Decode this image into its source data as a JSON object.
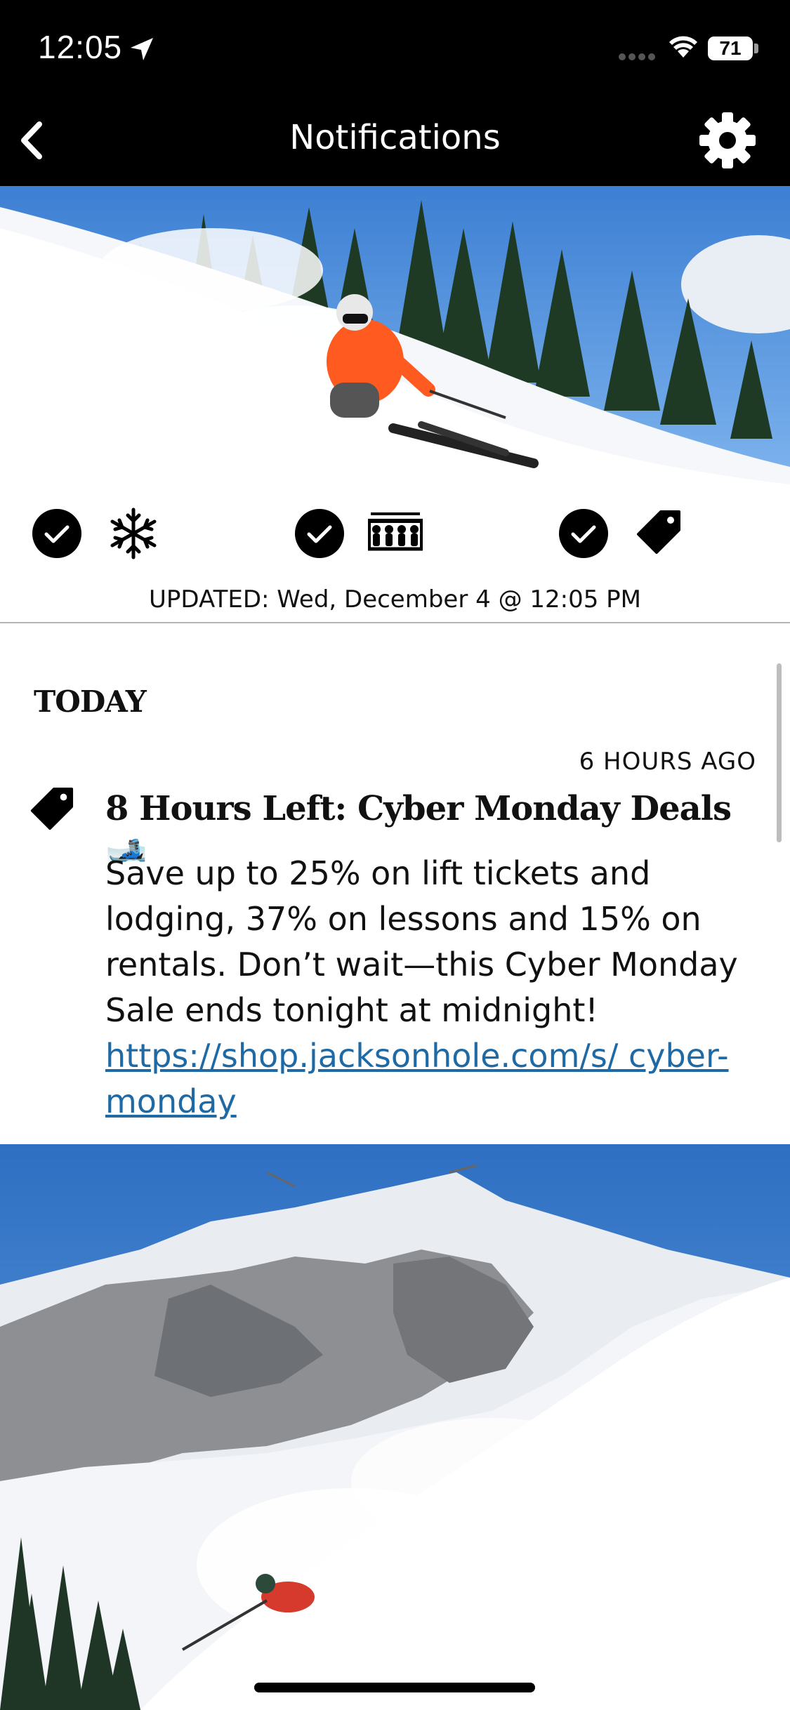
{
  "status_bar": {
    "time": "12:05",
    "battery": "71"
  },
  "nav": {
    "title": "Notifications"
  },
  "filters": [
    {
      "icon": "snowflake-icon",
      "checked": true
    },
    {
      "icon": "lift-chair-icon",
      "checked": true
    },
    {
      "icon": "price-tag-icon",
      "checked": true
    }
  ],
  "updated": "UPDATED: Wed, December 4 @ 12:05 PM",
  "section": {
    "header": "TODAY"
  },
  "notification": {
    "time_ago": "6 HOURS AGO",
    "title": "8 Hours Left: Cyber Monday Deals 🎿",
    "body": "Save up to 25% on lift tickets and lodging, 37% on lessons and 15% on rentals. Don’t wait—this Cyber Monday Sale ends tonight at midnight!",
    "link": "https://shop.jacksonhole.com/s/ cyber-monday",
    "icon": "price-tag-icon"
  },
  "colors": {
    "link": "#1f6aa5",
    "topbar": "#000000",
    "skier_jacket": "#ff5a1f"
  }
}
